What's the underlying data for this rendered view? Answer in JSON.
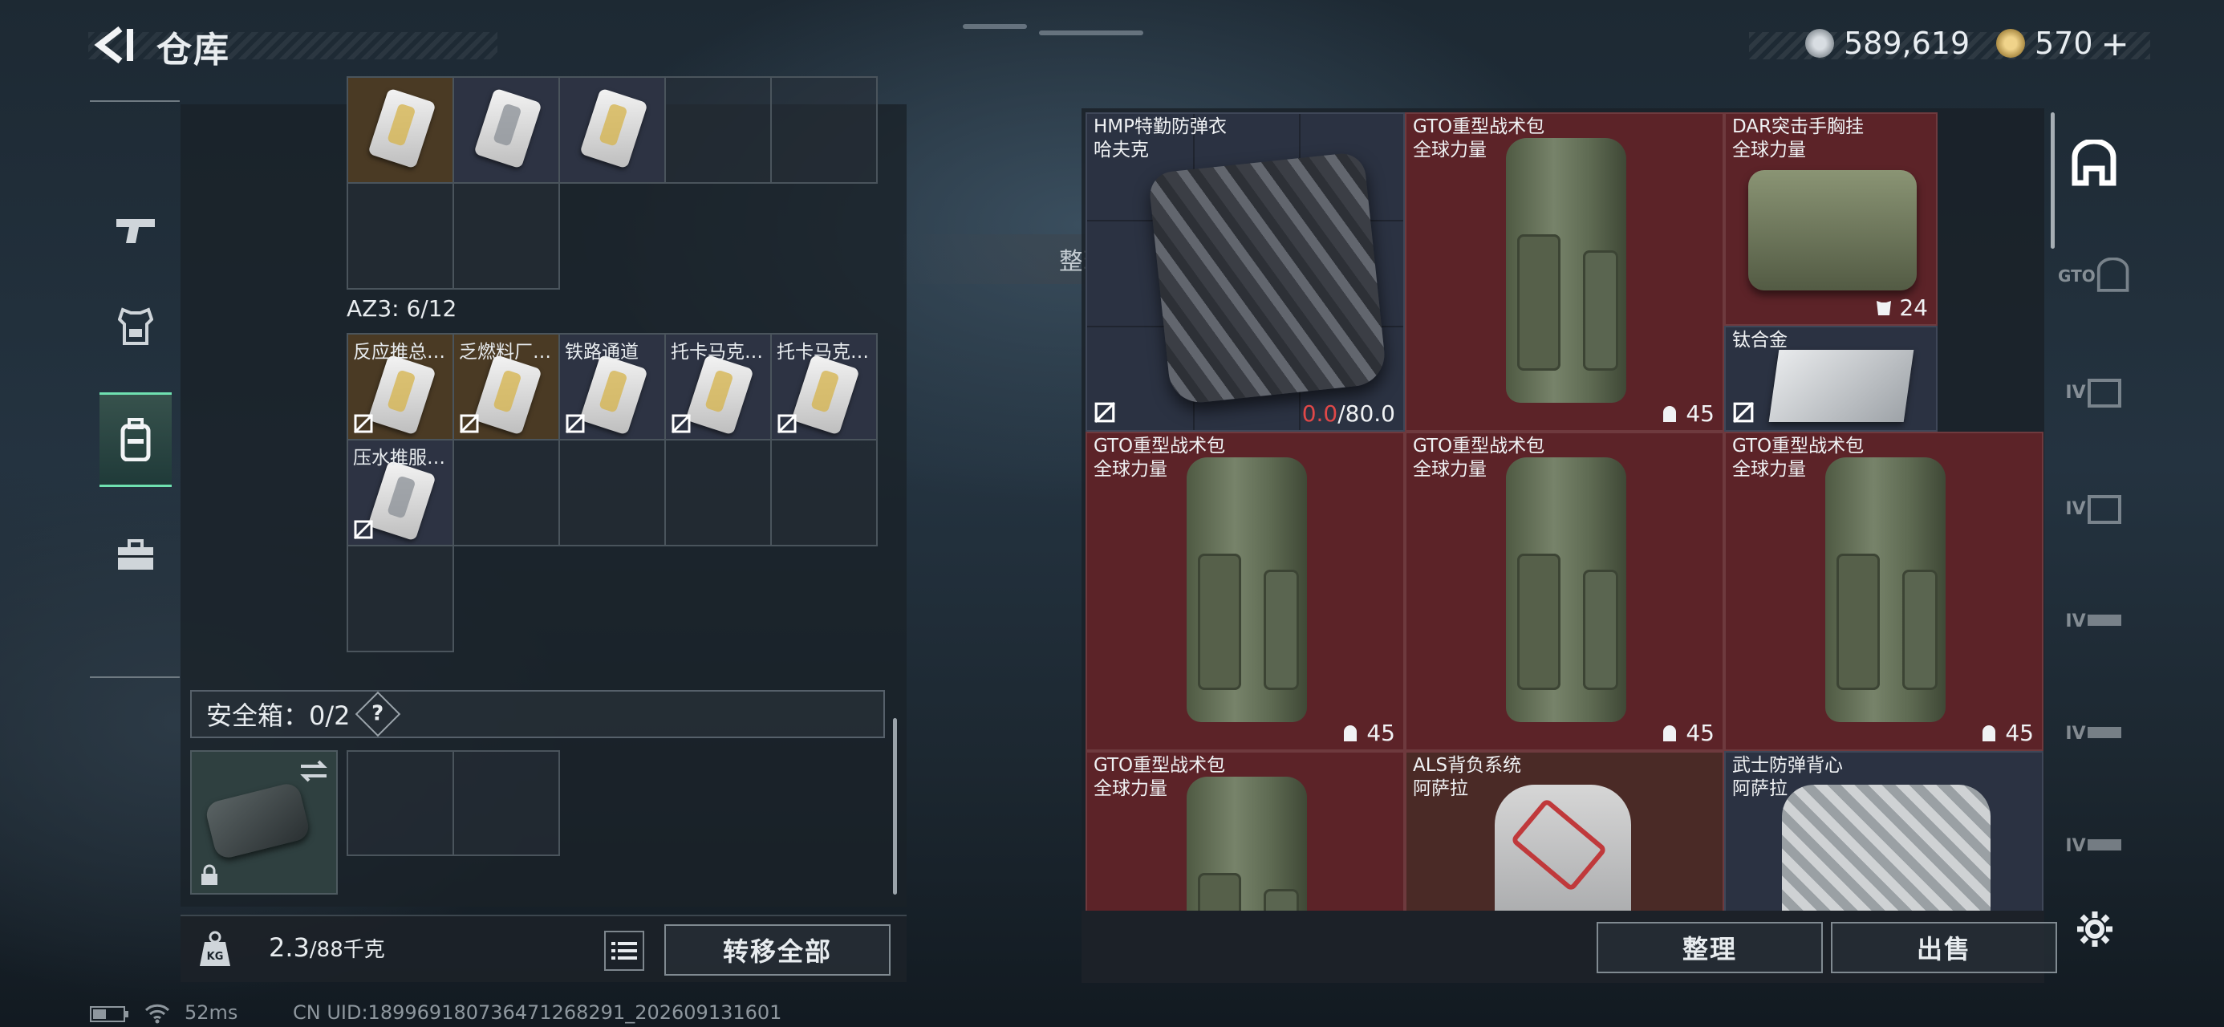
{
  "header": {
    "title": "仓库",
    "currency_silver": "589,619",
    "currency_gold": "570",
    "gold_plus": "+"
  },
  "left_nav": [
    "weapons-icon",
    "armor-icon",
    "backpack-icon",
    "toolbox-icon"
  ],
  "stash": {
    "container_label": "AZ3: 6/12",
    "items": [
      {
        "label": "反应推总…"
      },
      {
        "label": "乏燃料厂…"
      },
      {
        "label": "铁路通道"
      },
      {
        "label": "托卡马克…"
      },
      {
        "label": "托卡马克…"
      },
      {
        "label": "压水推服…"
      }
    ]
  },
  "safebox": {
    "label": "安全箱：0/2",
    "help": "?"
  },
  "weight": {
    "current": "2.3",
    "max": "/88千克",
    "icon_label": "KG"
  },
  "buttons": {
    "transfer_all": "转移全部",
    "organize": "整理",
    "sell": "出售"
  },
  "toast": "整理成功",
  "backpack_items": [
    {
      "name": "HMP特勤防弹衣",
      "brand": "哈夫克",
      "durability_now": "0.0",
      "durability_max": "/80.0"
    },
    {
      "name": "GTO重型战术包",
      "brand": "全球力量",
      "capacity": "45"
    },
    {
      "name": "DAR突击手胸挂",
      "brand": "全球力量",
      "capacity": "24"
    },
    {
      "name": "钛合金"
    },
    {
      "name": "GTO重型战术包",
      "brand": "全球力量",
      "capacity": "45"
    },
    {
      "name": "GTO重型战术包",
      "brand": "全球力量",
      "capacity": "45"
    },
    {
      "name": "GTO重型战术包",
      "brand": "全球力量",
      "capacity": "45"
    },
    {
      "name": "GTO重型战术包",
      "brand": "全球力量"
    },
    {
      "name": "ALS背负系统",
      "brand": "阿萨拉"
    },
    {
      "name": "武士防弹背心",
      "brand": "阿萨拉"
    }
  ],
  "right_nav_tiers": [
    "home-icon",
    "GTO",
    "IV",
    "IV",
    "IV",
    "IV",
    "IV"
  ],
  "status_bar": {
    "ping": "52ms",
    "uid": "CN UID:1899691807364712682​91_202609131601"
  },
  "colors": {
    "accent": "#6fe0b0",
    "red_slot": "#5c2328",
    "blue_slot": "#2b3242",
    "durability_low": "#e04848"
  }
}
